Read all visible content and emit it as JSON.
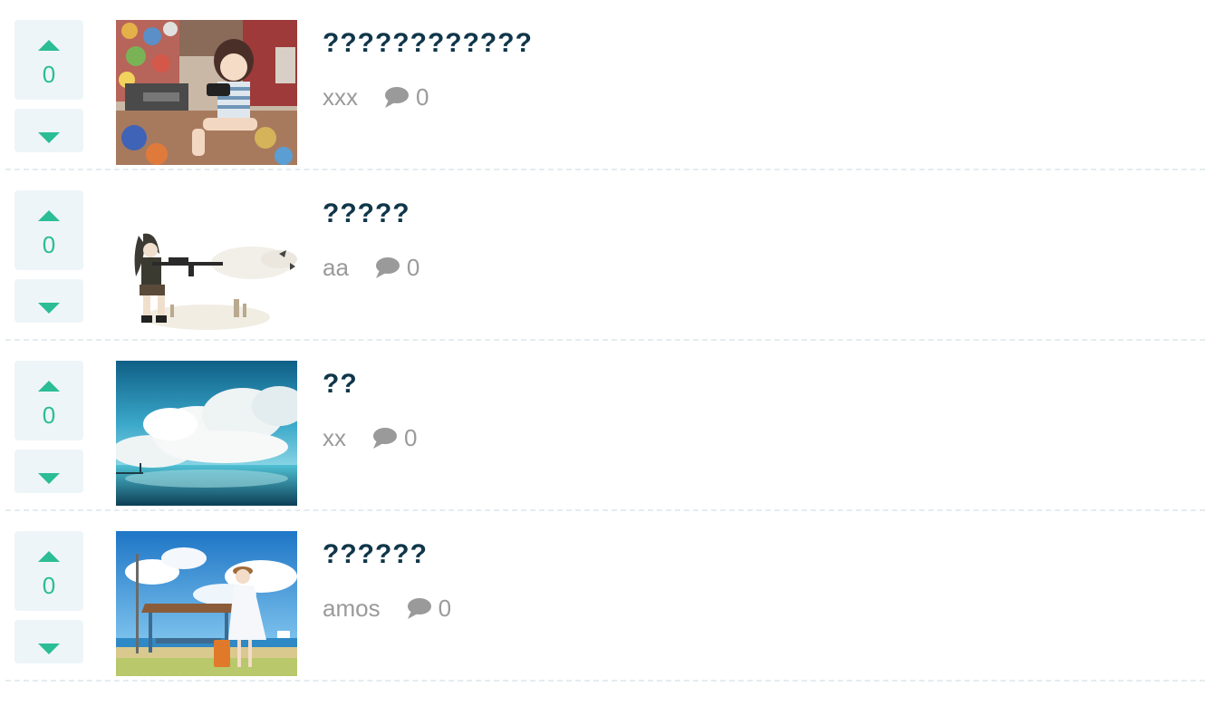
{
  "posts": [
    {
      "title": "????????????",
      "author": "xxx",
      "score": "0",
      "comments": "0",
      "thumbnail": "anime-girl-gaming-room"
    },
    {
      "title": "?????",
      "author": "aa",
      "score": "0",
      "comments": "0",
      "thumbnail": "anime-sniper-white-background"
    },
    {
      "title": "??",
      "author": "xx",
      "score": "0",
      "comments": "0",
      "thumbnail": "clouds-over-sea"
    },
    {
      "title": "??????",
      "author": "amos",
      "score": "0",
      "comments": "0",
      "thumbnail": "girl-at-seaside-bus-stop"
    }
  ],
  "icons": {
    "upvote": "caret-up-icon",
    "downvote": "caret-down-icon",
    "comment": "comment-bubble-icon"
  },
  "colors": {
    "accent": "#2bbd95",
    "title": "#10364a",
    "meta": "#9a9a9a",
    "vote_bg": "#eef5f8",
    "separator": "#e5ecef"
  }
}
